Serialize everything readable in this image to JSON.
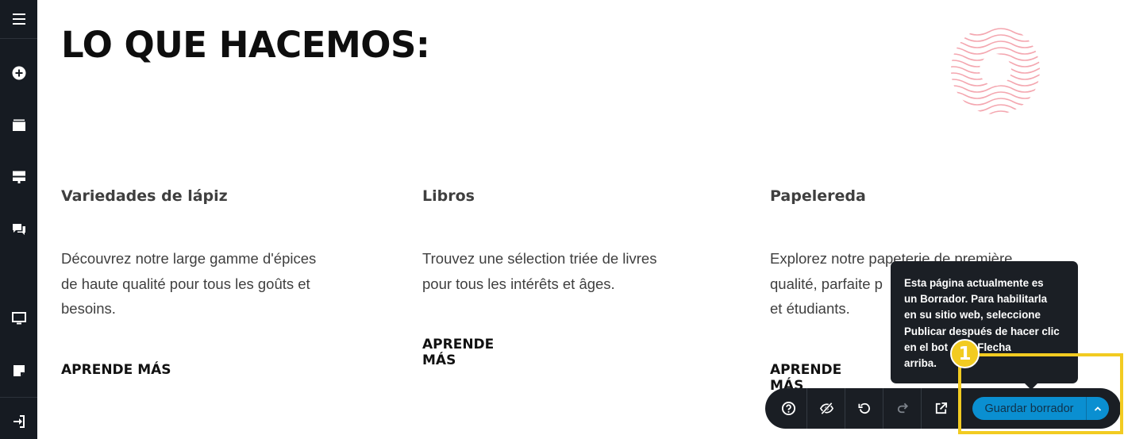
{
  "sidebar": {
    "items": [
      {
        "icon": "menu-icon"
      },
      {
        "icon": "add-circle-icon"
      },
      {
        "icon": "pages-icon"
      },
      {
        "icon": "sections-icon"
      },
      {
        "icon": "comments-icon"
      },
      {
        "icon": "desktop-preview-icon"
      },
      {
        "icon": "notes-icon"
      },
      {
        "icon": "exit-icon"
      }
    ]
  },
  "page": {
    "title": "LO QUE HACEMOS:",
    "columns": [
      {
        "heading": "Variedades de lápiz",
        "text_lines": [
          "Découvrez notre large gamme d'épices",
          "de haute qualité pour tous les goûts et",
          "besoins."
        ],
        "link": "APRENDE MÁS"
      },
      {
        "heading": "Libros",
        "text_lines": [
          "Trouvez une sélection triée de livres",
          "pour tous les intérêts et âges."
        ],
        "link": "APRENDE MÁS"
      },
      {
        "heading": "Papelereda",
        "text_lines": [
          "Explorez notre papeterie de première",
          "qualité, parfaite p",
          "et étudiants."
        ],
        "link": "APRENDE MÁS"
      }
    ]
  },
  "tooltip": {
    "lines": [
      "Esta página actualmente es",
      "un Borrador. Para habilitarla",
      "en su sitio web, seleccione",
      "Publicar después de hacer clic",
      "en el bot   e la Flecha",
      "arriba."
    ]
  },
  "annotation": {
    "step": "1",
    "color": "#f2cb21"
  },
  "toolbar": {
    "buttons": [
      "help-icon",
      "hide-icon",
      "undo-icon",
      "redo-icon",
      "external-preview-icon"
    ],
    "save_label": "Guardar borrador",
    "accent": "#0a8fd1"
  }
}
